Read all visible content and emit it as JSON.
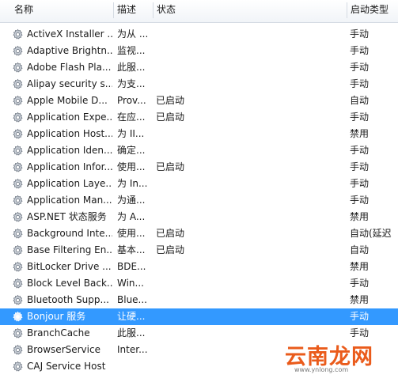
{
  "columns": {
    "name": "名称",
    "description": "描述",
    "status": "状态",
    "startup_type": "启动类型"
  },
  "services": [
    {
      "name": "ActiveX Installer ...",
      "description": "为从 ...",
      "status": "",
      "startup_type": "手动"
    },
    {
      "name": "Adaptive Brightn...",
      "description": "监视...",
      "status": "",
      "startup_type": "手动"
    },
    {
      "name": "Adobe Flash Pla...",
      "description": "此服...",
      "status": "",
      "startup_type": "手动"
    },
    {
      "name": "Alipay security s...",
      "description": "为支...",
      "status": "",
      "startup_type": "手动"
    },
    {
      "name": "Apple Mobile D...",
      "description": "Prov...",
      "status": "已启动",
      "startup_type": "自动"
    },
    {
      "name": "Application Expe...",
      "description": "在应...",
      "status": "已启动",
      "startup_type": "手动"
    },
    {
      "name": "Application Host...",
      "description": "为 II...",
      "status": "",
      "startup_type": "禁用"
    },
    {
      "name": "Application Iden...",
      "description": "确定...",
      "status": "",
      "startup_type": "手动"
    },
    {
      "name": "Application Infor...",
      "description": "使用...",
      "status": "已启动",
      "startup_type": "手动"
    },
    {
      "name": "Application Laye...",
      "description": "为 In...",
      "status": "",
      "startup_type": "手动"
    },
    {
      "name": "Application Man...",
      "description": "为通...",
      "status": "",
      "startup_type": "手动"
    },
    {
      "name": "ASP.NET 状态服务",
      "description": "为 A...",
      "status": "",
      "startup_type": "禁用"
    },
    {
      "name": "Background Inte...",
      "description": "使用...",
      "status": "已启动",
      "startup_type": "自动(延迟"
    },
    {
      "name": "Base Filtering En...",
      "description": "基本...",
      "status": "已启动",
      "startup_type": "自动"
    },
    {
      "name": "BitLocker Drive ...",
      "description": "BDE...",
      "status": "",
      "startup_type": "禁用"
    },
    {
      "name": "Block Level Back...",
      "description": "Win...",
      "status": "",
      "startup_type": "手动"
    },
    {
      "name": "Bluetooth Supp...",
      "description": "Blue...",
      "status": "",
      "startup_type": "禁用"
    },
    {
      "name": "Bonjour 服务",
      "description": "让硬...",
      "status": "",
      "startup_type": "手动",
      "selected": true
    },
    {
      "name": "BranchCache",
      "description": "此服...",
      "status": "",
      "startup_type": "手动"
    },
    {
      "name": "BrowserService",
      "description": "Inter...",
      "status": "",
      "startup_type": "禁用"
    },
    {
      "name": "CAJ Service Host",
      "description": "",
      "status": "",
      "startup_type": ""
    }
  ],
  "icon": "gear-icon",
  "selection_color": "#3399ff",
  "watermark": {
    "text": "云南龙网",
    "url": "www.ynlong.com"
  }
}
